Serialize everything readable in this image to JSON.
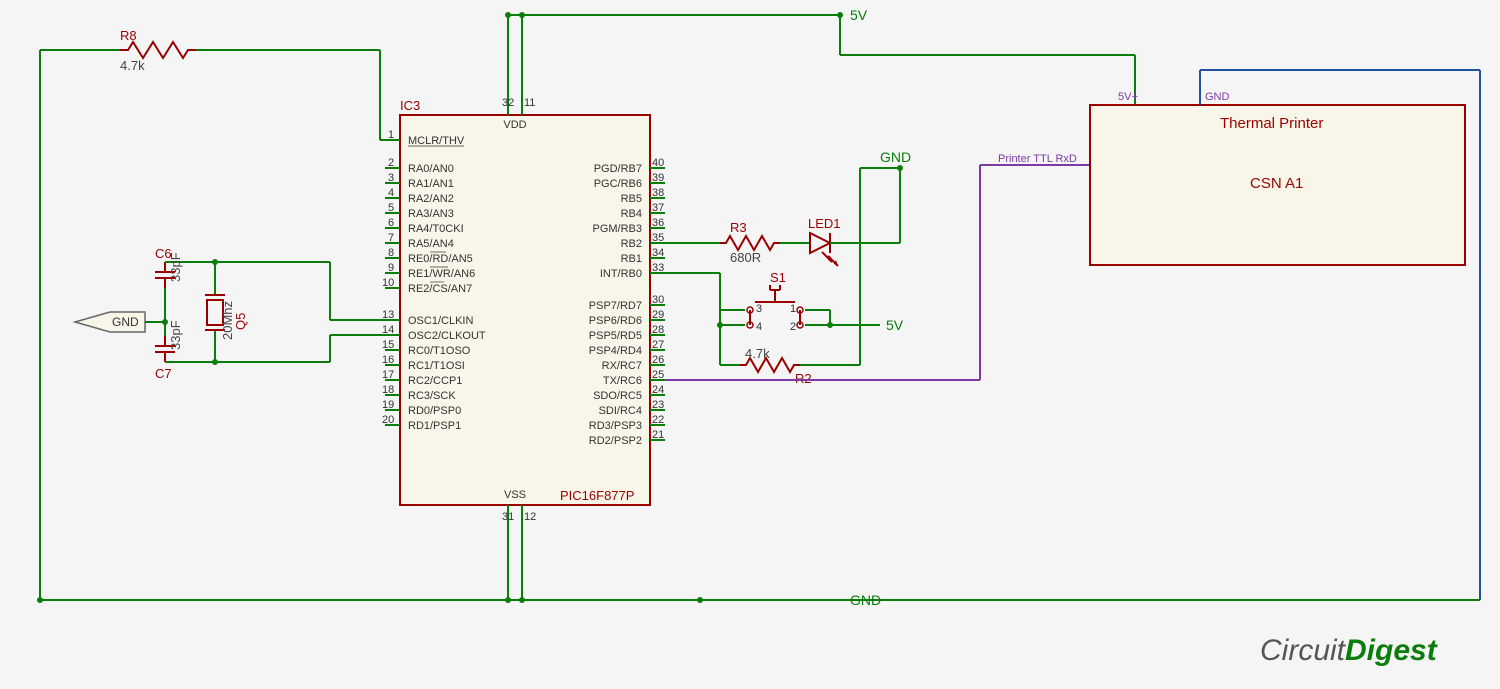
{
  "power": {
    "vcc": "5V",
    "gnd": "GND"
  },
  "ic": {
    "ref": "IC3",
    "part": "PIC16F877P",
    "vdd": "VDD",
    "vss": "VSS",
    "pins_left": [
      {
        "num": "1",
        "name": "MCLR/THV"
      },
      {
        "num": "2",
        "name": "RA0/AN0"
      },
      {
        "num": "3",
        "name": "RA1/AN1"
      },
      {
        "num": "4",
        "name": "RA2/AN2"
      },
      {
        "num": "5",
        "name": "RA3/AN3"
      },
      {
        "num": "6",
        "name": "RA4/T0CKI"
      },
      {
        "num": "7",
        "name": "RA5/AN4"
      },
      {
        "num": "8",
        "name": "RE0/RD/AN5"
      },
      {
        "num": "9",
        "name": "RE1/WR/AN6"
      },
      {
        "num": "10",
        "name": "RE2/CS/AN7"
      },
      {
        "num": "13",
        "name": "OSC1/CLKIN"
      },
      {
        "num": "14",
        "name": "OSC2/CLKOUT"
      },
      {
        "num": "15",
        "name": "RC0/T1OSO"
      },
      {
        "num": "16",
        "name": "RC1/T1OSI"
      },
      {
        "num": "17",
        "name": "RC2/CCP1"
      },
      {
        "num": "18",
        "name": "RC3/SCK"
      },
      {
        "num": "19",
        "name": "RD0/PSP0"
      },
      {
        "num": "20",
        "name": "RD1/PSP1"
      }
    ],
    "pins_right": [
      {
        "num": "40",
        "name": "PGD/RB7"
      },
      {
        "num": "39",
        "name": "PGC/RB6"
      },
      {
        "num": "38",
        "name": "RB5"
      },
      {
        "num": "37",
        "name": "RB4"
      },
      {
        "num": "36",
        "name": "PGM/RB3"
      },
      {
        "num": "35",
        "name": "RB2"
      },
      {
        "num": "34",
        "name": "RB1"
      },
      {
        "num": "33",
        "name": "INT/RB0"
      },
      {
        "num": "30",
        "name": "PSP7/RD7"
      },
      {
        "num": "29",
        "name": "PSP6/RD6"
      },
      {
        "num": "28",
        "name": "PSP5/RD5"
      },
      {
        "num": "27",
        "name": "PSP4/RD4"
      },
      {
        "num": "26",
        "name": "RX/RC7"
      },
      {
        "num": "25",
        "name": "TX/RC6"
      },
      {
        "num": "24",
        "name": "SDO/RC5"
      },
      {
        "num": "23",
        "name": "SDI/RC4"
      },
      {
        "num": "22",
        "name": "RD3/PSP3"
      },
      {
        "num": "21",
        "name": "RD2/PSP2"
      }
    ],
    "pins_top": [
      {
        "num": "32"
      },
      {
        "num": "11"
      }
    ],
    "pins_bot": [
      {
        "num": "31"
      },
      {
        "num": "12"
      }
    ]
  },
  "components": {
    "R8": {
      "ref": "R8",
      "val": "4.7k"
    },
    "R3": {
      "ref": "R3",
      "val": "680R"
    },
    "R2": {
      "ref": "R2",
      "val": "4.7k"
    },
    "C6": {
      "ref": "C6",
      "val": "33pF"
    },
    "C7": {
      "ref": "C7",
      "val": "33pF"
    },
    "Q5": {
      "ref": "Q5",
      "val": "20Mhz"
    },
    "LED1": {
      "ref": "LED1"
    },
    "S1": {
      "ref": "S1",
      "pins": {
        "1": "1",
        "2": "2",
        "3": "3",
        "4": "4"
      }
    }
  },
  "printer": {
    "title": "Thermal Printer",
    "model": "CSN A1",
    "pins": {
      "vcc": "5V+",
      "gnd": "GND",
      "rx": "Printer TTL RxD"
    }
  },
  "brand": {
    "a": "Circuit",
    "b": "Digest"
  }
}
